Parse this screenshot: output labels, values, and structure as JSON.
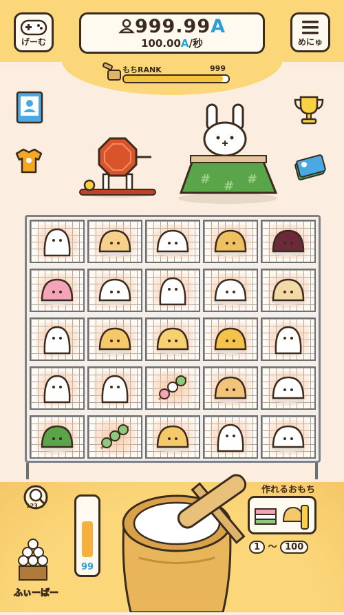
{
  "header": {
    "game_button_label": "げーむ",
    "menu_button_label": "めにゅ",
    "money_value": "999.99",
    "money_unit": "A",
    "rate_value": "100.00",
    "rate_unit": "A",
    "rate_suffix": "/秒",
    "rank_label": "もちRANK",
    "rank_value": "999",
    "rank_progress": 0.95
  },
  "icons": {
    "profile_book": "profile-book-icon",
    "shirt": "shirt-icon",
    "trophy": "trophy-icon",
    "cards": "cards-icon",
    "search": "search-icon"
  },
  "grid": {
    "rows": [
      [
        "plain-mochi",
        "cake-roll",
        "daifuku",
        "sweet-potato-plate",
        "ohagi"
      ],
      [
        "sakura-mochi",
        "dango-parfait",
        "plain-mochi",
        "strawberry-daifuku",
        "donut-mochi"
      ],
      [
        "plain-mochi",
        "pon-de-ring",
        "custard-bun",
        "pancake-stack",
        "plain-mochi"
      ],
      [
        "glowing-mochi",
        "glowing-mochi",
        "three-color-dango",
        "crepe",
        "mochi-on-plate"
      ],
      [
        "matcha-mochi",
        "matcha-dango",
        "melon-bread",
        "plain-mochi",
        "daifuku"
      ]
    ]
  },
  "bottom": {
    "meter_value": "99",
    "meter_level": 0.75,
    "can_make_label": "作れるおもち",
    "range_min": "1",
    "range_tilde": "〜",
    "range_max": "100",
    "feeder_label": "ふぃーばー",
    "search_hint": "123..."
  },
  "colors": {
    "accent": "#fbd77a",
    "money_unit": "#2aa0d8",
    "outline": "#3b2a1e"
  }
}
